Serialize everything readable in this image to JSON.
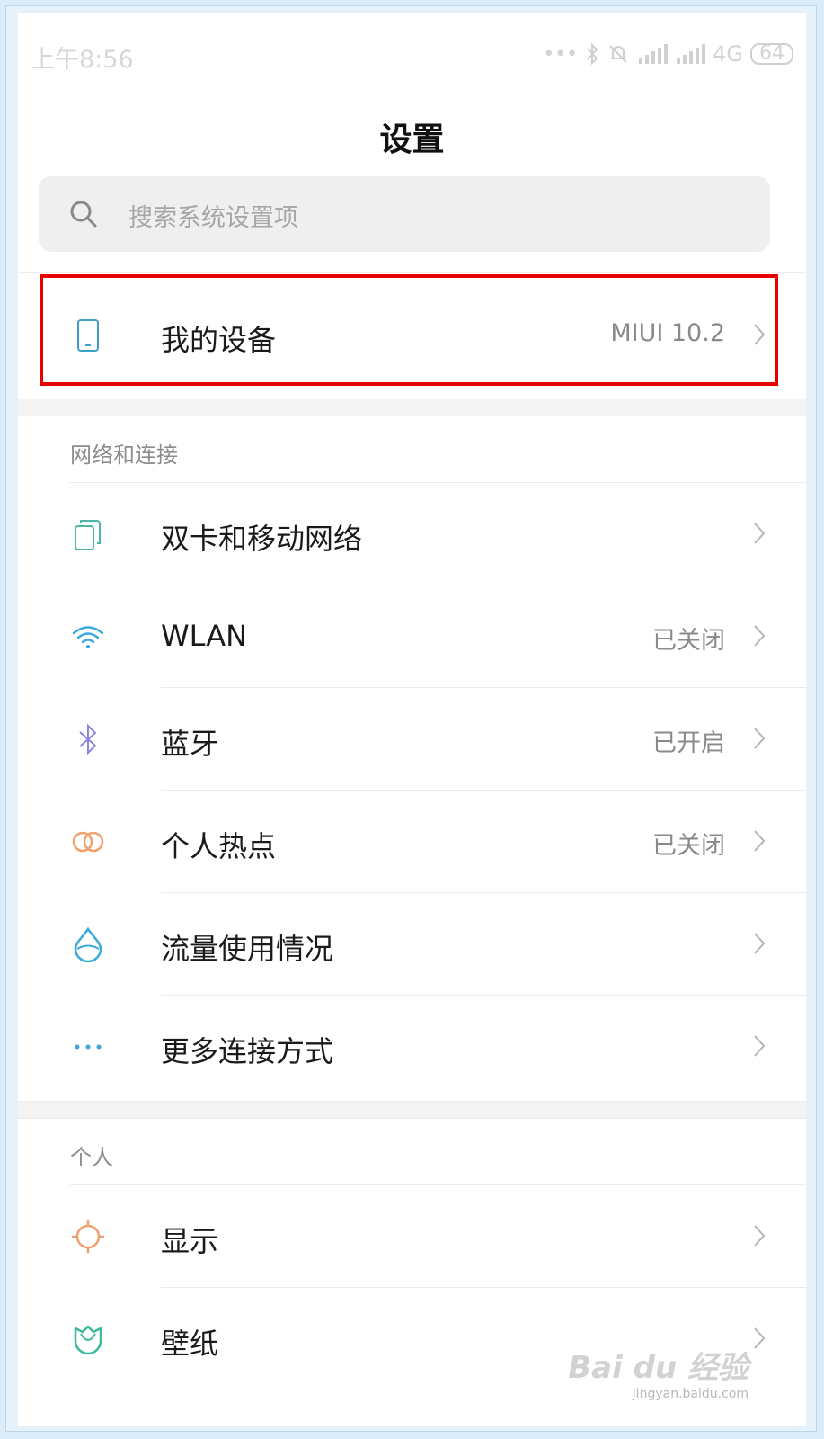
{
  "status_bar": {
    "time": "上午8:56",
    "network": "4G",
    "battery": "64"
  },
  "page_title": "设置",
  "search": {
    "placeholder": "搜索系统设置项"
  },
  "my_device": {
    "label": "我的设备",
    "value": "MIUI 10.2"
  },
  "sections": [
    {
      "header": "网络和连接",
      "items": [
        {
          "label": "双卡和移动网络",
          "value": "",
          "icon": "dual-sim-icon",
          "color": "#4bb8a6"
        },
        {
          "label": "WLAN",
          "value": "已关闭",
          "icon": "wifi-icon",
          "color": "#38a8e0"
        },
        {
          "label": "蓝牙",
          "value": "已开启",
          "icon": "bluetooth-icon",
          "color": "#8b84e0"
        },
        {
          "label": "个人热点",
          "value": "已关闭",
          "icon": "hotspot-icon",
          "color": "#f0a06a"
        },
        {
          "label": "流量使用情况",
          "value": "",
          "icon": "data-usage-icon",
          "color": "#3aa8d8"
        },
        {
          "label": "更多连接方式",
          "value": "",
          "icon": "more-icon",
          "color": "#3aa8d8"
        }
      ]
    },
    {
      "header": "个人",
      "items": [
        {
          "label": "显示",
          "value": "",
          "icon": "brightness-icon",
          "color": "#f0a06a"
        },
        {
          "label": "壁纸",
          "value": "",
          "icon": "wallpaper-icon",
          "color": "#3bb89a"
        }
      ]
    }
  ],
  "watermark": {
    "brand": "Bai du 经验",
    "url": "jingyan.baidu.com"
  }
}
